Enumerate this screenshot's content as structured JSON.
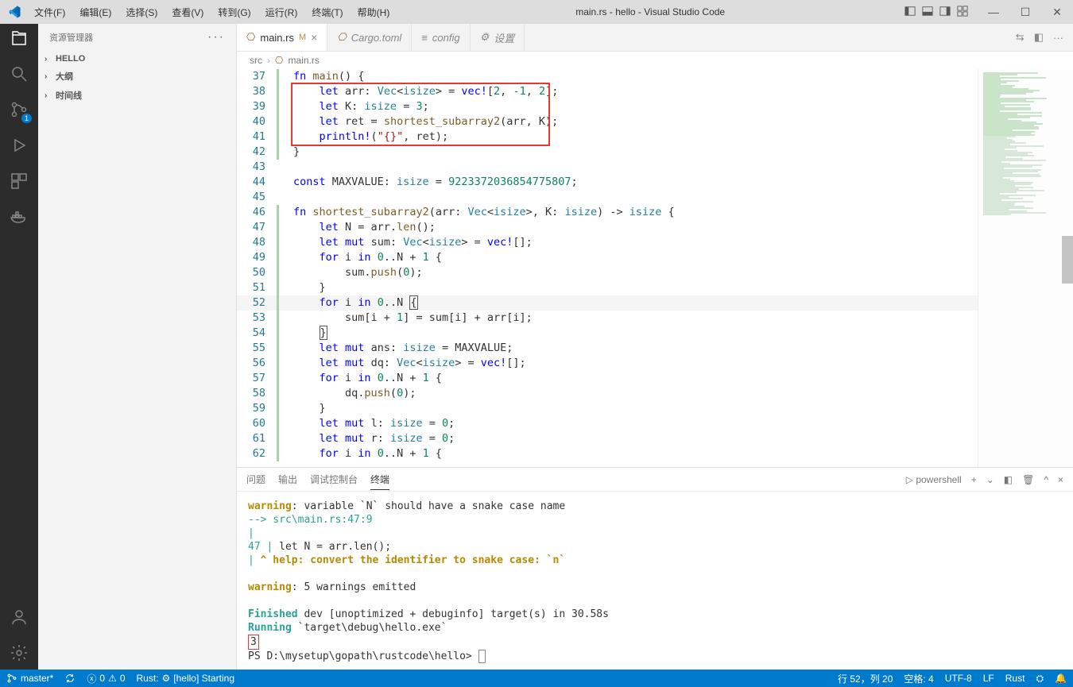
{
  "title": "main.rs - hello - Visual Studio Code",
  "menu": {
    "file": "文件(F)",
    "edit": "编辑(E)",
    "select": "选择(S)",
    "view": "查看(V)",
    "goto": "转到(G)",
    "run": "运行(R)",
    "terminal": "终端(T)",
    "help": "帮助(H)"
  },
  "sidebar": {
    "title": "资源管理器",
    "sections": [
      "HELLO",
      "大纲",
      "时间线"
    ]
  },
  "tabs": [
    {
      "label": "main.rs",
      "badge": "M",
      "active": true,
      "icon": "rust"
    },
    {
      "label": "Cargo.toml",
      "active": false,
      "icon": "rust"
    },
    {
      "label": "config",
      "active": false,
      "icon": "cfg"
    },
    {
      "label": "设置",
      "active": false,
      "icon": "cfg"
    }
  ],
  "breadcrumb": {
    "a": "src",
    "b": "main.rs"
  },
  "code": {
    "lines": [
      {
        "n": 37,
        "mod": "g",
        "html": "<span class='kw'>fn</span> <span class='fn'>main</span>() {"
      },
      {
        "n": 38,
        "mod": "g",
        "html": "    <span class='kw'>let</span> arr: <span class='ty'>Vec</span>&lt;<span class='ty'>isize</span>&gt; = <span class='mac'>vec!</span>[<span class='num'>2</span>, <span class='num'>-1</span>, <span class='num'>2</span>];"
      },
      {
        "n": 39,
        "mod": "g",
        "html": "    <span class='kw'>let</span> K: <span class='ty'>isize</span> = <span class='num'>3</span>;"
      },
      {
        "n": 40,
        "mod": "g",
        "html": "    <span class='kw'>let</span> ret = <span class='fn'>shortest_subarray2</span>(arr, K);"
      },
      {
        "n": 41,
        "mod": "g",
        "html": "    <span class='mac'>println!</span>(<span class='str'>\"{}\"</span>, ret);"
      },
      {
        "n": 42,
        "mod": "g",
        "html": "}"
      },
      {
        "n": 43,
        "mod": "n",
        "html": ""
      },
      {
        "n": 44,
        "mod": "n",
        "html": "<span class='kw'>const</span> MAXVALUE: <span class='ty'>isize</span> = <span class='num'>9223372036854775807</span>;"
      },
      {
        "n": 45,
        "mod": "n",
        "html": ""
      },
      {
        "n": 46,
        "mod": "g",
        "html": "<span class='kw'>fn</span> <span class='fn'>shortest_subarray2</span>(arr: <span class='ty'>Vec</span>&lt;<span class='ty'>isize</span>&gt;, K: <span class='ty'>isize</span>) -&gt; <span class='ty'>isize</span> {"
      },
      {
        "n": 47,
        "mod": "g",
        "html": "    <span class='kw'>let</span> N = arr.<span class='fn'>len</span>();"
      },
      {
        "n": 48,
        "mod": "g",
        "html": "    <span class='kw'>let</span> <span class='kw'>mut</span> sum: <span class='ty'>Vec</span>&lt;<span class='ty'>isize</span>&gt; = <span class='mac'>vec!</span>[];"
      },
      {
        "n": 49,
        "mod": "g",
        "html": "    <span class='kw'>for</span> i <span class='kw'>in</span> <span class='num'>0</span>..N + <span class='num'>1</span> {"
      },
      {
        "n": 50,
        "mod": "g",
        "html": "        sum.<span class='fn'>push</span>(<span class='num'>0</span>);"
      },
      {
        "n": 51,
        "mod": "g",
        "html": "    }"
      },
      {
        "n": 52,
        "mod": "g",
        "hl": true,
        "html": "    <span class='kw'>for</span> i <span class='kw'>in</span> <span class='num'>0</span>..N <span class='cursor-box'>{</span>"
      },
      {
        "n": 53,
        "mod": "g",
        "html": "        sum[i + <span class='num'>1</span>] = sum[i] + arr[i];"
      },
      {
        "n": 54,
        "mod": "g",
        "html": "    <span class='cursor-box'>}</span>"
      },
      {
        "n": 55,
        "mod": "g",
        "html": "    <span class='kw'>let</span> <span class='kw'>mut</span> ans: <span class='ty'>isize</span> = MAXVALUE;"
      },
      {
        "n": 56,
        "mod": "g",
        "html": "    <span class='kw'>let</span> <span class='kw'>mut</span> dq: <span class='ty'>Vec</span>&lt;<span class='ty'>isize</span>&gt; = <span class='mac'>vec!</span>[];"
      },
      {
        "n": 57,
        "mod": "g",
        "html": "    <span class='kw'>for</span> i <span class='kw'>in</span> <span class='num'>0</span>..N + <span class='num'>1</span> {"
      },
      {
        "n": 58,
        "mod": "g",
        "html": "        dq.<span class='fn'>push</span>(<span class='num'>0</span>);"
      },
      {
        "n": 59,
        "mod": "g",
        "html": "    }"
      },
      {
        "n": 60,
        "mod": "g",
        "html": "    <span class='kw'>let</span> <span class='kw'>mut</span> l: <span class='ty'>isize</span> = <span class='num'>0</span>;"
      },
      {
        "n": 61,
        "mod": "g",
        "html": "    <span class='kw'>let</span> <span class='kw'>mut</span> r: <span class='ty'>isize</span> = <span class='num'>0</span>;"
      },
      {
        "n": 62,
        "mod": "g",
        "html": "    <span class='kw'>for</span> i <span class='kw'>in</span> <span class='num'>0</span>..N + <span class='num'>1</span> {"
      }
    ]
  },
  "panel": {
    "tabs": [
      "问题",
      "输出",
      "调试控制台",
      "终端"
    ],
    "active": 3,
    "shell": "powershell",
    "warn1a": "warning",
    "warn1b": ": variable `N` should have a snake case name",
    "loc": "  --> src\\main.rs:47:9",
    "pipe": "   |",
    "ln": "47",
    "codeln": "     let N = arr.len();",
    "help": "         ^ help: convert the identifier to snake case: `n`",
    "warn2": ": 5 warnings emitted",
    "finished": "Finished",
    "finished2": " dev [unoptimized + debuginfo] target(s) in 30.58s",
    "running": "Running",
    "running2": " `target\\debug\\hello.exe`",
    "out": "3",
    "prompt": "PS D:\\mysetup\\gopath\\rustcode\\hello> "
  },
  "status": {
    "branch": "master*",
    "errors": "0",
    "warns": "0",
    "rust": "Rust: ",
    "rust2": "[hello] Starting",
    "pos": "行 52，列 20",
    "spaces": "空格: 4",
    "enc": "UTF-8",
    "eol": "LF",
    "lang": "Rust"
  },
  "scm_badge": "1"
}
